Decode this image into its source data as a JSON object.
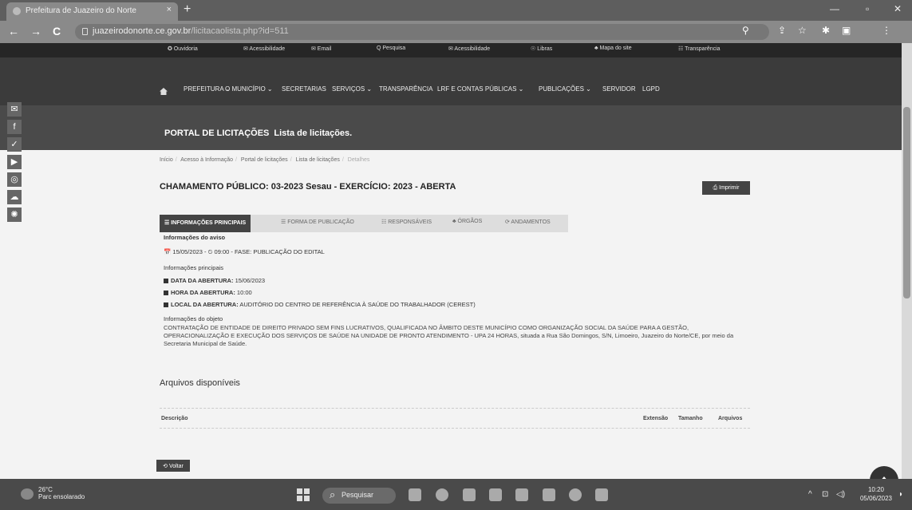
{
  "browser": {
    "tab_title": "Prefeitura de Juazeiro do Norte",
    "tab_close": "×",
    "new_tab": "+",
    "url_host": "juazeirodonorte.ce.gov.br",
    "url_path": "/licitacaolista.php?id=511",
    "back": "←",
    "forward": "→",
    "reload": "C"
  },
  "topbar": [
    "✪ Ouvidoria",
    "✉ Acessibilidade",
    "✉ Email",
    "Q Pesquisa",
    "✉ Acessibilidade",
    "☉ Libras",
    "♣ Mapa do site",
    "☷ Transparência"
  ],
  "menu": [
    "PREFEITURA ⌄",
    "O MUNICÍPIO ⌄",
    "SECRETARIAS",
    "SERVIÇOS ⌄",
    "TRANSPARÊNCIA",
    "LRF E CONTAS PÚBLICAS ⌄",
    "PUBLICAÇÕES ⌄",
    "SERVIDOR",
    "LGPD"
  ],
  "hero": {
    "title": "PORTAL DE LICITAÇÕES",
    "subtitle": "Lista de licitações."
  },
  "social": [
    "✉",
    "f",
    "✓",
    "▶",
    "◎",
    "☁",
    "✺"
  ],
  "breadcrumb": [
    "Início",
    "Acesso à Informação",
    "Portal de licitações",
    "Lista de licitações",
    "Detalhes"
  ],
  "page": {
    "title": "CHAMAMENTO PÚBLICO: 03-2023 Sesau - EXERCÍCIO: 2023 - ABERTA",
    "print_label": "⎙ Imprimir"
  },
  "tabs": [
    "☰ INFORMAÇÕES PRINCIPAIS",
    "☰ FORMA DE PUBLICAÇÃO",
    "☷ RESPONSÁVEIS",
    "♣ ÓRGÃOS",
    "⟳ ANDAMENTOS"
  ],
  "aviso": {
    "heading": "Informações do aviso",
    "line": "📅 15/05/2023 - ⏲ 09:00 - FASE: PUBLICAÇÃO DO EDITAL"
  },
  "principais": {
    "heading": "Informações principais",
    "items": [
      {
        "label": "DATA DA ABERTURA:",
        "value": "15/06/2023"
      },
      {
        "label": "HORA DA ABERTURA:",
        "value": "10:00"
      },
      {
        "label": "LOCAL DA ABERTURA:",
        "value": "AUDITÓRIO DO CENTRO DE REFERÊNCIA À SAÚDE DO TRABALHADOR (CEREST)"
      }
    ]
  },
  "objeto": {
    "heading": "Informações do objeto",
    "text": "CONTRATAÇÃO DE ENTIDADE DE DIREITO PRIVADO SEM FINS LUCRATIVOS, QUALIFICADA NO ÂMBITO DESTE MUNICÍPIO COMO ORGANIZAÇÃO SOCIAL DA SAÚDE PARA A GESTÃO, OPERACIONALIZAÇÃO E EXECUÇÃO DOS SERVIÇOS DE SAÚDE NA UNIDADE DE PRONTO ATENDIMENTO - UPA 24 HORAS, situada a Rua São Domingos, S/N, Limoeiro, Juazeiro do Norte/CE, por meio da Secretaria Municipal de Saúde."
  },
  "arquivos": {
    "heading": "Arquivos disponíveis",
    "columns": [
      "Descrição",
      "Extensão",
      "Tamanho",
      "Arquivos"
    ]
  },
  "voltar_label": "⟲ Voltar",
  "taskbar": {
    "temp": "26°C",
    "weather": "Parc ensolarado",
    "search": "Pesquisar",
    "time": "10:20",
    "date": "05/06/2023"
  }
}
